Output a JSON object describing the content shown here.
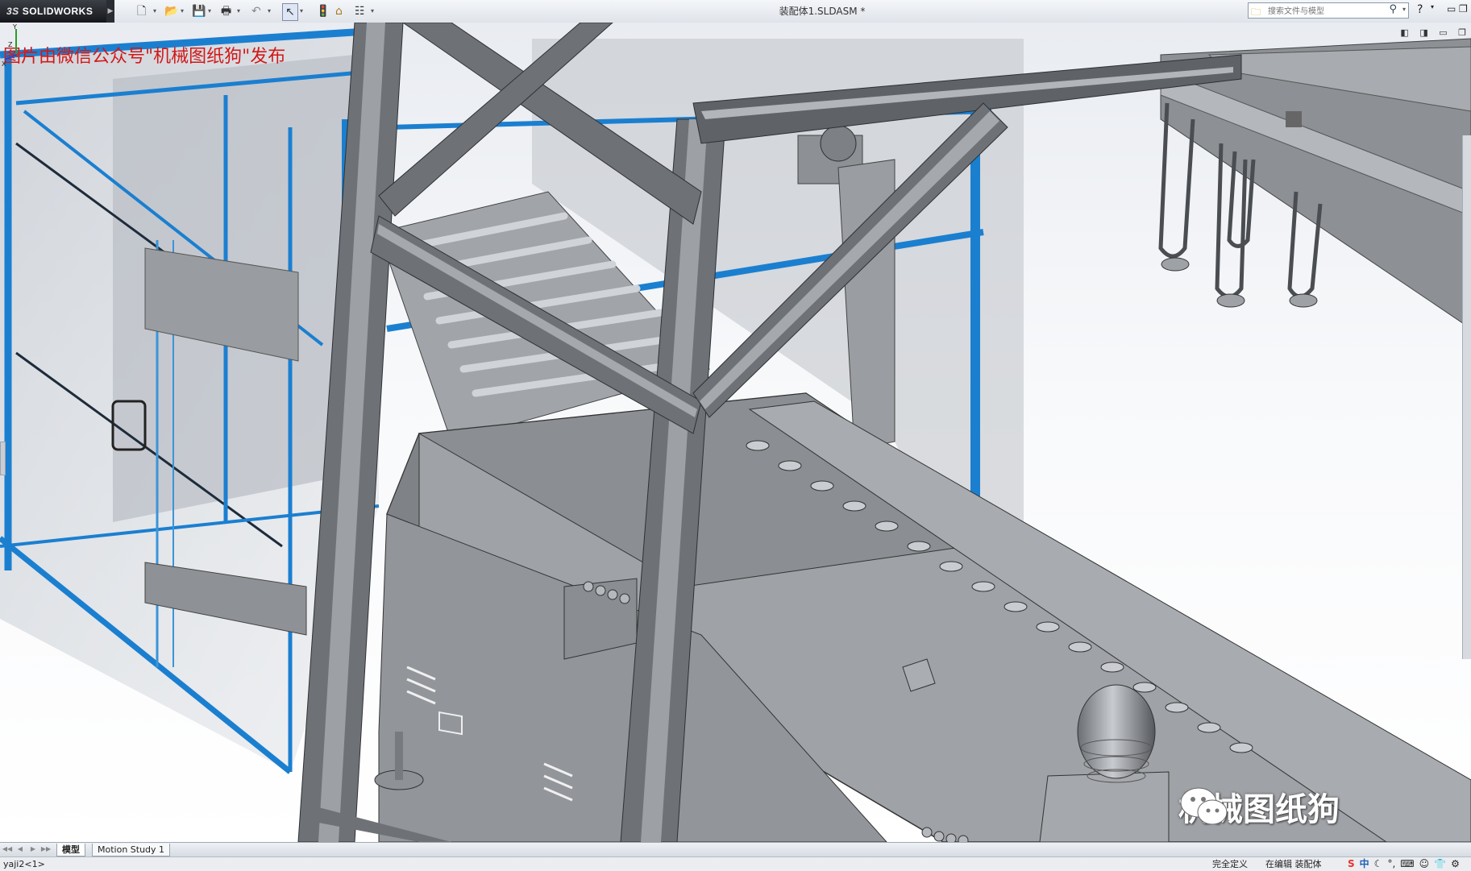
{
  "app": {
    "brand": "SOLIDWORKS",
    "brand_ds": "3S",
    "document_title": "装配体1.SLDASM *"
  },
  "toolbar": {
    "icons": [
      "new-icon",
      "open-icon",
      "save-icon",
      "print-icon",
      "undo-icon",
      "select-icon",
      "rebuild-icon",
      "file-properties-icon",
      "options-icon"
    ]
  },
  "search": {
    "placeholder": "搜索文件与模型"
  },
  "help": {
    "label": "?"
  },
  "watermarks": {
    "top": "图片由微信公众号\"机械图纸狗\"发布",
    "brand": "机械图纸狗"
  },
  "tabs": [
    {
      "label": "模型",
      "active": true
    },
    {
      "label": "Motion Study 1",
      "active": false
    }
  ],
  "status": {
    "part": "yaji2<1>",
    "definition": "完全定义",
    "editing": "在编辑 装配体"
  },
  "ime": {
    "logo": "S",
    "lang": "中"
  },
  "colors": {
    "frame_blue": "#1b7fd0",
    "profile_gray": "#6e7276",
    "metal_gray": "#9a9da1",
    "watermark_red": "#d21818"
  }
}
